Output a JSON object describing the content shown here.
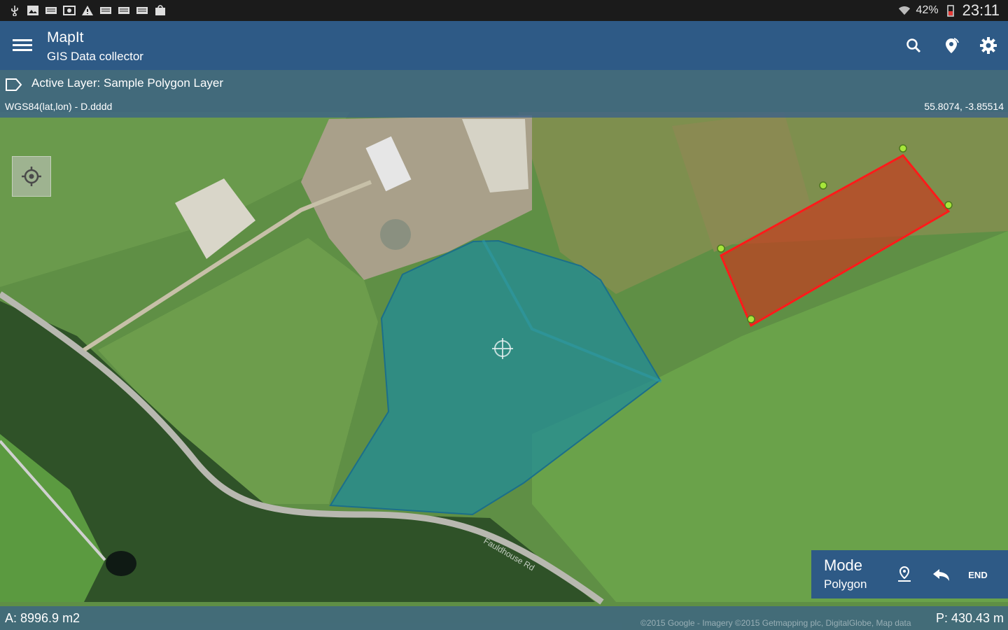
{
  "status_bar": {
    "battery": "42%",
    "time": "23:11"
  },
  "app_bar": {
    "title": "MapIt",
    "subtitle": "GIS Data collector",
    "icons": [
      "menu-icon",
      "search-icon",
      "gps-settings-icon",
      "gear-icon"
    ]
  },
  "layer_bar": {
    "active_layer": "Active Layer: Sample Polygon Layer",
    "crs": "WGS84(lat,lon) - D.dddd",
    "coordinates": "55.8074, -3.85514"
  },
  "map": {
    "polygon_fill_blue": "#1e8a9a",
    "polygon_fill_red": "#c83a1e",
    "polygon_stroke_red": "#ff1a1a",
    "vertex_color": "#a6e63a",
    "road_label": "Fauldhouse Rd"
  },
  "mode_panel": {
    "title": "Mode",
    "value": "Polygon",
    "end_label": "END"
  },
  "bottom_bar": {
    "area": "A: 8996.9 m2",
    "perimeter": "P: 430.43 m",
    "attribution": "©2015 Google - Imagery ©2015 Getmapping plc, DigitalGlobe, Map data"
  }
}
